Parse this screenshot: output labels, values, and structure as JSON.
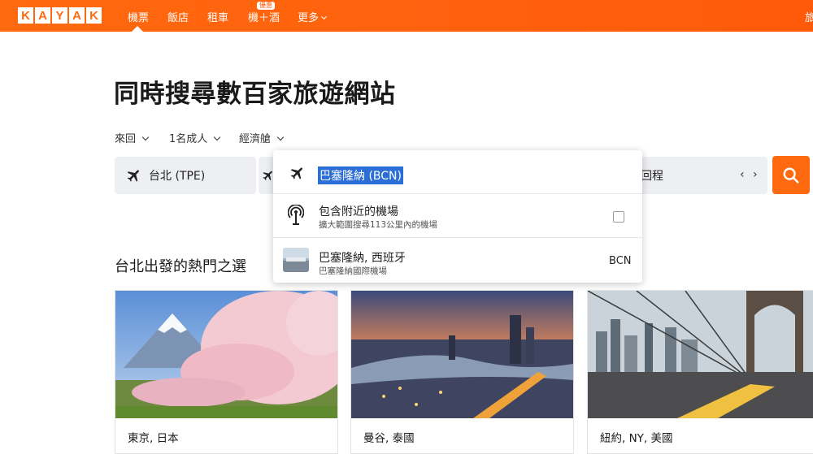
{
  "brand": {
    "logo_letters": [
      "K",
      "A",
      "Y",
      "A",
      "K"
    ]
  },
  "nav": {
    "items": [
      {
        "label": "機票"
      },
      {
        "label": "飯店"
      },
      {
        "label": "租車"
      },
      {
        "label": "機＋酒"
      },
      {
        "label": "更多"
      }
    ],
    "deal_badge": "優惠",
    "right_partial": "旅"
  },
  "headline": "同時搜尋數百家旅遊網站",
  "options": {
    "trip_type": "來回",
    "travelers": "1名成人",
    "cabin": "經濟艙"
  },
  "search": {
    "origin": "台北 (TPE)",
    "return_label": "回程"
  },
  "dropdown": {
    "input_value": "巴塞隆納 (BCN)",
    "nearby": {
      "title": "包含附近的機場",
      "subtitle": "擴大範圍搜尋113公里內的機場",
      "checked": false
    },
    "result": {
      "title": "巴塞隆納, 西班牙",
      "subtitle": "巴塞隆納國際機場",
      "code": "BCN"
    }
  },
  "popular": {
    "title": "台北出發的熱門之選",
    "cards": [
      {
        "caption": "東京, 日本",
        "image": "mount-fuji-cherry-blossom"
      },
      {
        "caption": "曼谷, 泰國",
        "image": "bangkok-river-sunset"
      },
      {
        "caption": "紐約, NY, 美國",
        "image": "brooklyn-bridge"
      }
    ]
  },
  "colors": {
    "brand": "#ff690f",
    "highlight": "#2b6fd6",
    "field_bg": "#edeff2"
  }
}
